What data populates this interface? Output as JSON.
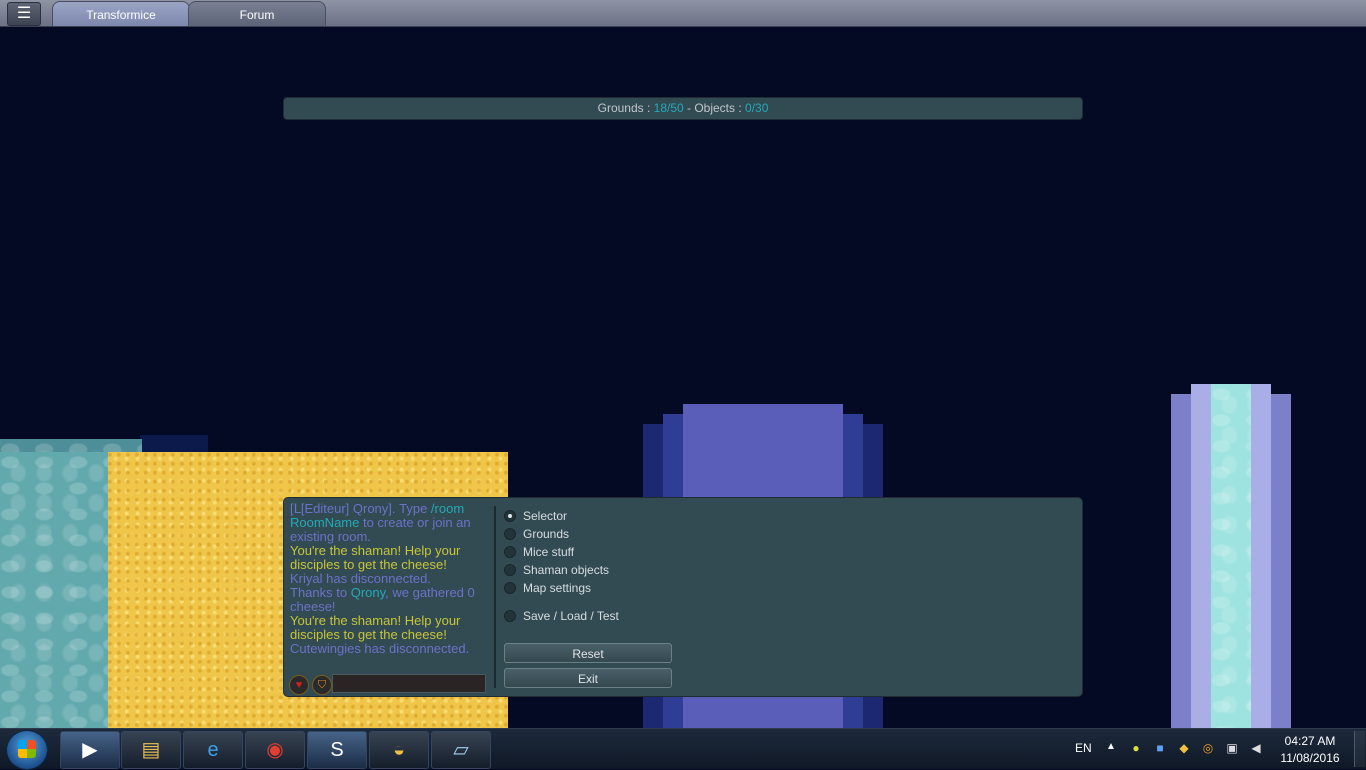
{
  "topbar": {
    "tabs": [
      {
        "label": "Transformice",
        "active": true
      },
      {
        "label": "Forum",
        "active": false
      }
    ]
  },
  "counter": {
    "grounds_label": "Grounds : ",
    "grounds_value": "18/50",
    "separator": " - Objects : ",
    "objects_value": "0/30"
  },
  "chat": {
    "messages": [
      {
        "text": "[ᒪ[Editeur] Qrony]. Type ",
        "color": "violet"
      },
      {
        "text": "/room RoomName",
        "color": "cyan"
      },
      {
        "text": " to create or join an existing room.",
        "color": "violet"
      },
      {
        "text": "You're the shaman! Help your disciples to get the cheese!",
        "color": "yellow"
      },
      {
        "text": "Kriyal has disconnected.",
        "color": "violet"
      },
      {
        "text": "Thanks to ",
        "color": "violet"
      },
      {
        "text": "Qrony",
        "color": "cyan"
      },
      {
        "text": ", we gathered 0 cheese!",
        "color": "violet"
      },
      {
        "text": "You're the shaman! Help your disciples to get the cheese!",
        "color": "yellow"
      },
      {
        "text": "Cutewingies has disconnected.",
        "color": "violet"
      }
    ],
    "input_value": ""
  },
  "editor": {
    "options": [
      {
        "label": "Selector",
        "selected": true
      },
      {
        "label": "Grounds",
        "selected": false
      },
      {
        "label": "Mice stuff",
        "selected": false
      },
      {
        "label": "Shaman objects",
        "selected": false
      },
      {
        "label": "Map settings",
        "selected": false
      }
    ],
    "save_option": "Save / Load / Test",
    "reset_label": "Reset",
    "exit_label": "Exit"
  },
  "taskbar": {
    "apps": [
      "media-player-icon",
      "file-explorer-icon",
      "internet-explorer-icon",
      "chrome-icon",
      "skype-icon",
      "transformice-cheese-icon",
      "notepad-icon"
    ],
    "language": "EN",
    "time": "04:27 AM",
    "date": "11/08/2016"
  },
  "colors": {
    "background": "#050a24",
    "panel": "#324a52",
    "accent_cyan": "#25a9b8",
    "chat_violet": "#6c72c8",
    "chat_yellow": "#c7c637"
  }
}
